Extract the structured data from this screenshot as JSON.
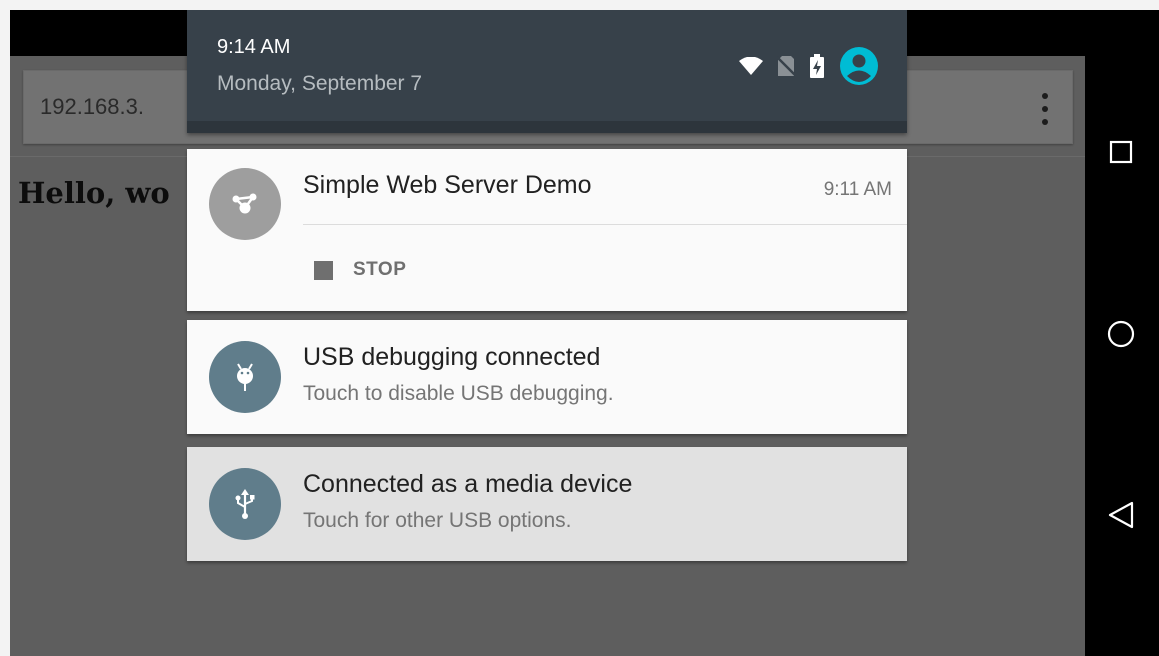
{
  "status": {
    "time": "9:14 AM",
    "date": "Monday, September 7",
    "icons": [
      "wifi-icon",
      "no-sim-icon",
      "battery-charging-icon",
      "account-icon"
    ],
    "account_color": "#00bcd4"
  },
  "browser": {
    "url": "192.168.3.",
    "page_heading": "Hello, wo"
  },
  "notifications": [
    {
      "title": "Simple Web Server Demo",
      "time": "9:11 AM",
      "icon": "share-icon",
      "action_label": "STOP"
    },
    {
      "title": "USB debugging connected",
      "subtitle": "Touch to disable USB debugging.",
      "icon": "android-debug-icon"
    },
    {
      "title": "Connected as a media device",
      "subtitle": "Touch for other USB options.",
      "icon": "usb-icon"
    }
  ],
  "navbar": {
    "buttons": [
      "recents-icon",
      "home-icon",
      "back-icon"
    ]
  }
}
